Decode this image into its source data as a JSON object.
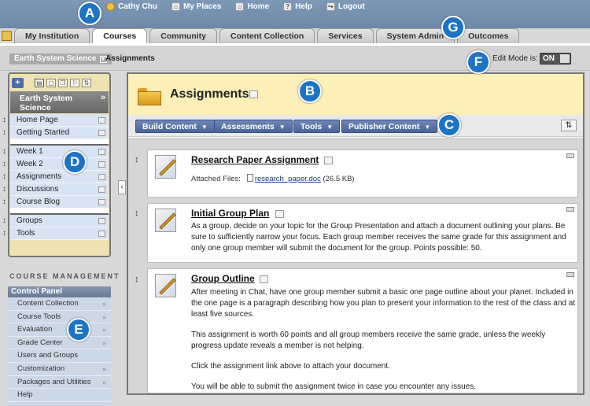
{
  "topmenu": {
    "user": "Cathy Chu",
    "my_places": "My Places",
    "home": "Home",
    "help": "Help",
    "logout": "Logout"
  },
  "tabs": [
    {
      "label": "My Institution"
    },
    {
      "label": "Courses"
    },
    {
      "label": "Community"
    },
    {
      "label": "Content Collection"
    },
    {
      "label": "Services"
    },
    {
      "label": "System Admin"
    },
    {
      "label": "Outcomes"
    }
  ],
  "breadcrumb": {
    "course": "Earth System Science",
    "page": "Assignments"
  },
  "edit_mode": {
    "label": "Edit Mode is:",
    "state": "ON"
  },
  "callouts": {
    "a": "A",
    "b": "B",
    "c": "C",
    "d": "D",
    "e": "E",
    "f": "F",
    "g": "G"
  },
  "course_menu": {
    "title": "Earth System Science",
    "add_icon": "+",
    "group1": [
      "Home Page",
      "Getting Started"
    ],
    "group2": [
      "Week 1",
      "Week 2",
      "Assignments",
      "Discussions",
      "Course Blog"
    ],
    "group3": [
      "Groups",
      "Tools"
    ]
  },
  "course_management": {
    "heading": "COURSE MANAGEMENT",
    "panel_title": "Control Panel",
    "items": [
      "Content Collection",
      "Course Tools",
      "Evaluation",
      "Grade Center",
      "Users and Groups",
      "Customization",
      "Packages and Utilities",
      "Help"
    ]
  },
  "content": {
    "title": "Assignments",
    "action_buttons": [
      "Build Content",
      "Assessments",
      "Tools",
      "Publisher Content"
    ],
    "items": [
      {
        "title": "Research Paper Assignment",
        "attached_label": "Attached Files:",
        "file_name": "research_paper.doc",
        "file_size": "(26.5 KB)"
      },
      {
        "title": "Initial Group Plan",
        "paragraphs": [
          "As a group, decide on your topic for the Group Presentation and attach a document outlining your plans. Be sure to sufficiently narrow your focus. Each group member receives the same grade for this assignment and only one group member will submit the document for the group. Points possible: 50."
        ]
      },
      {
        "title": "Group Outline",
        "paragraphs": [
          "After meeting in Chat, have one group member submit a basic one page outline about your planet. Included in the one page is a paragraph describing how you plan to present your information to the rest of the class and at least five sources.",
          "This assignment is worth 60 points and all group members receive the same grade, unless the weekly progress update reveals a member is not helping.",
          "Click the assignment link above to attach your document.",
          "You will be able to submit the assignment twice in case you encounter any issues."
        ]
      }
    ]
  },
  "icons": {
    "user": "user-icon",
    "places": "places-icon",
    "home": "home-icon",
    "help": "help-icon",
    "logout": "logout-icon",
    "folder": "folder-icon",
    "assignment": "assignment-icon",
    "move": "move-handle-icon",
    "chevron": "chevron-down-icon"
  },
  "colors": {
    "accent": "#1d74c4",
    "topbar": "#7690b0",
    "titlebar": "#fcefb8",
    "button": "#4b6598",
    "course_menu": "#efe2b2"
  }
}
